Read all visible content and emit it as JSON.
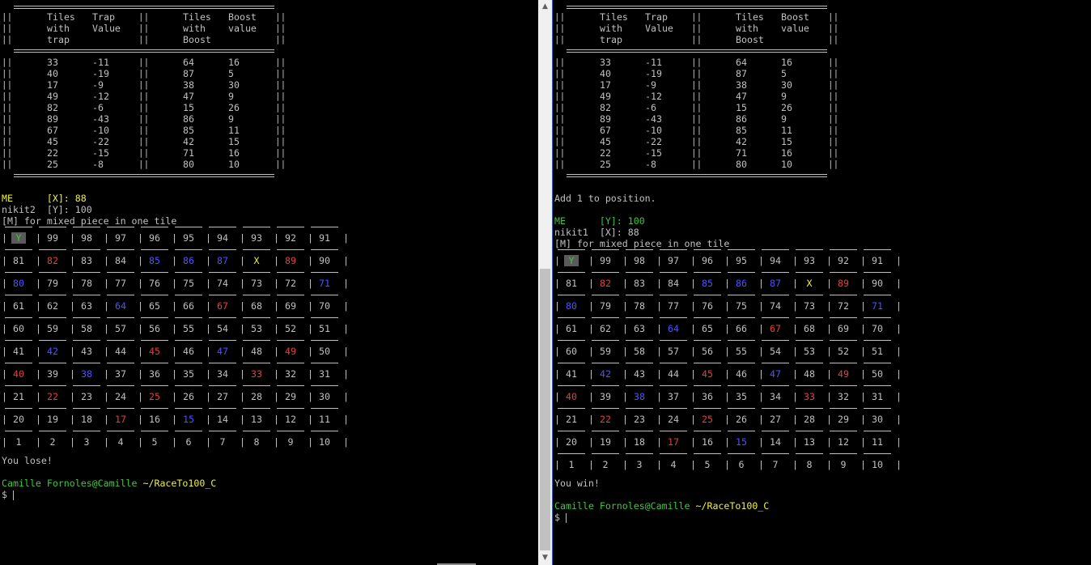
{
  "table": {
    "headers": {
      "trap_tiles": [
        "Tiles",
        "with",
        "trap"
      ],
      "trap_value": [
        "Trap",
        "Value"
      ],
      "boost_tiles": [
        "Tiles",
        "with",
        "Boost"
      ],
      "boost_value": [
        "Boost",
        "value"
      ]
    },
    "rows": [
      [
        "33",
        "-11",
        "64",
        "16"
      ],
      [
        "40",
        "-19",
        "87",
        "5"
      ],
      [
        "17",
        "-9",
        "38",
        "30"
      ],
      [
        "49",
        "-12",
        "47",
        "9"
      ],
      [
        "82",
        "-6",
        "15",
        "26"
      ],
      [
        "89",
        "-43",
        "86",
        "9"
      ],
      [
        "67",
        "-10",
        "85",
        "11"
      ],
      [
        "45",
        "-22",
        "42",
        "15"
      ],
      [
        "22",
        "-15",
        "71",
        "16"
      ],
      [
        "25",
        "-8",
        "80",
        "10"
      ]
    ]
  },
  "board": [
    [
      "Y",
      "99",
      "98",
      "97",
      "96",
      "95",
      "94",
      "93",
      "92",
      "91"
    ],
    [
      "81",
      "82",
      "83",
      "84",
      "85",
      "86",
      "87",
      "X",
      "89",
      "90"
    ],
    [
      "80",
      "79",
      "78",
      "77",
      "76",
      "75",
      "74",
      "73",
      "72",
      "71"
    ],
    [
      "61",
      "62",
      "63",
      "64",
      "65",
      "66",
      "67",
      "68",
      "69",
      "70"
    ],
    [
      "60",
      "59",
      "58",
      "57",
      "56",
      "55",
      "54",
      "53",
      "52",
      "51"
    ],
    [
      "41",
      "42",
      "43",
      "44",
      "45",
      "46",
      "47",
      "48",
      "49",
      "50"
    ],
    [
      "40",
      "39",
      "38",
      "37",
      "36",
      "35",
      "34",
      "33",
      "32",
      "31"
    ],
    [
      "21",
      "22",
      "23",
      "24",
      "25",
      "26",
      "27",
      "28",
      "29",
      "30"
    ],
    [
      "20",
      "19",
      "18",
      "17",
      "16",
      "15",
      "14",
      "13",
      "12",
      "11"
    ],
    [
      "1",
      "2",
      "3",
      "4",
      "5",
      "6",
      "7",
      "8",
      "9",
      "10"
    ]
  ],
  "colors": {
    "trap": "#e04040",
    "boost": "#5050ff",
    "player_x": "#f0f040",
    "player_y": "#3ec83e",
    "text": "#c0c0c0"
  },
  "left": {
    "me_label": "ME",
    "me_marker": "[X]: 88",
    "opponent": "nikit2  [Y]: 100",
    "legend": "[M] for mixed piece in one tile",
    "result": "You lose!",
    "prompt_user": "Camille Fornoles@Camille",
    "prompt_path": "~/RaceTo100_C",
    "prompt_symbol": "$"
  },
  "right": {
    "message": "Add 1 to position.",
    "me_label": "ME",
    "me_marker": "[Y]: 100",
    "opponent": "nikit1  [X]: 88",
    "legend": "[M] for mixed piece in one tile",
    "result": "You win!",
    "prompt_user": "Camille Fornoles@Camille",
    "prompt_path": "~/RaceTo100_C",
    "prompt_symbol": "$"
  },
  "scrollbar": {
    "up": "▲",
    "down": "▼"
  }
}
